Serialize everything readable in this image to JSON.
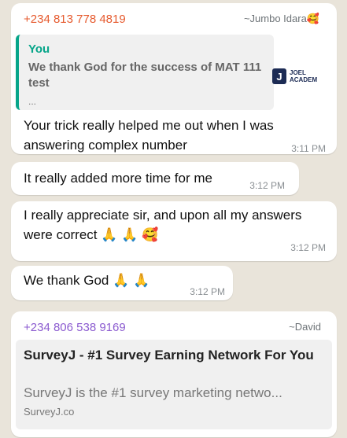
{
  "messages": [
    {
      "sender": "+234 813 778 4819",
      "push_name": "~Jumbo Idara",
      "push_emoji": "🥰",
      "quote": {
        "name": "You",
        "text": "We thank God for the success of MAT 111 test",
        "more": "...",
        "logo_letter": "J",
        "logo_line1": "JOEL",
        "logo_line2": "ACADEM"
      },
      "text": "Your trick really helped me out when I was answering complex number",
      "time": "3:11 PM"
    },
    {
      "text": "It really added more time for me",
      "time": "3:12 PM"
    },
    {
      "text": "I really appreciate sir, and upon all  my answers were correct",
      "emojis": "🙏 🙏 🥰",
      "time": "3:12 PM"
    },
    {
      "text": "We thank God",
      "emojis": "🙏 🙏",
      "time": "3:12 PM"
    },
    {
      "sender": "+234 806 538 9169",
      "push_name": "~David",
      "link_preview": {
        "title": "SurveyJ - #1 Survey Earning Network For You",
        "description": "SurveyJ is the #1 survey marketing netwo...",
        "url": "SurveyJ.co"
      }
    }
  ]
}
